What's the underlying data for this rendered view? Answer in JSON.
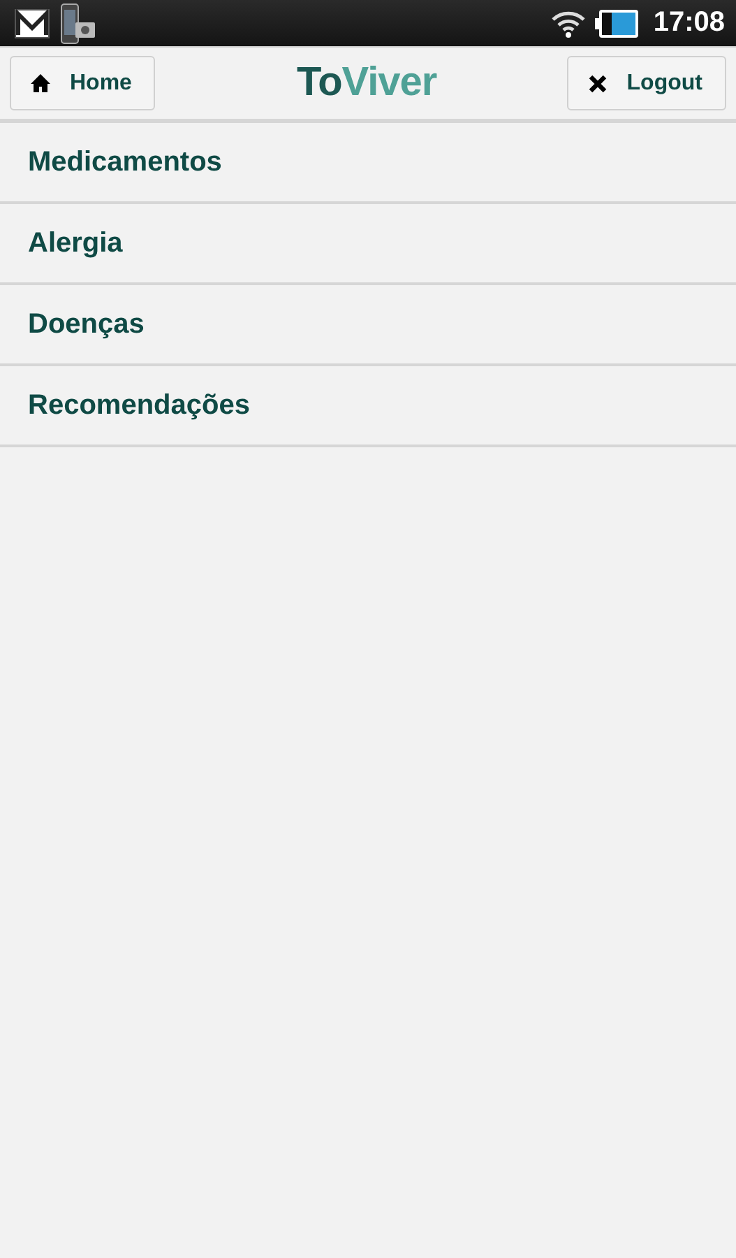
{
  "status_bar": {
    "time": "17:08"
  },
  "header": {
    "home_button": "Home",
    "logo": {
      "first": "To",
      "second": "Viver"
    },
    "logout_button": "Logout"
  },
  "menu": [
    {
      "label": "Medicamentos"
    },
    {
      "label": "Alergia"
    },
    {
      "label": "Doenças"
    },
    {
      "label": "Recomendações"
    }
  ]
}
